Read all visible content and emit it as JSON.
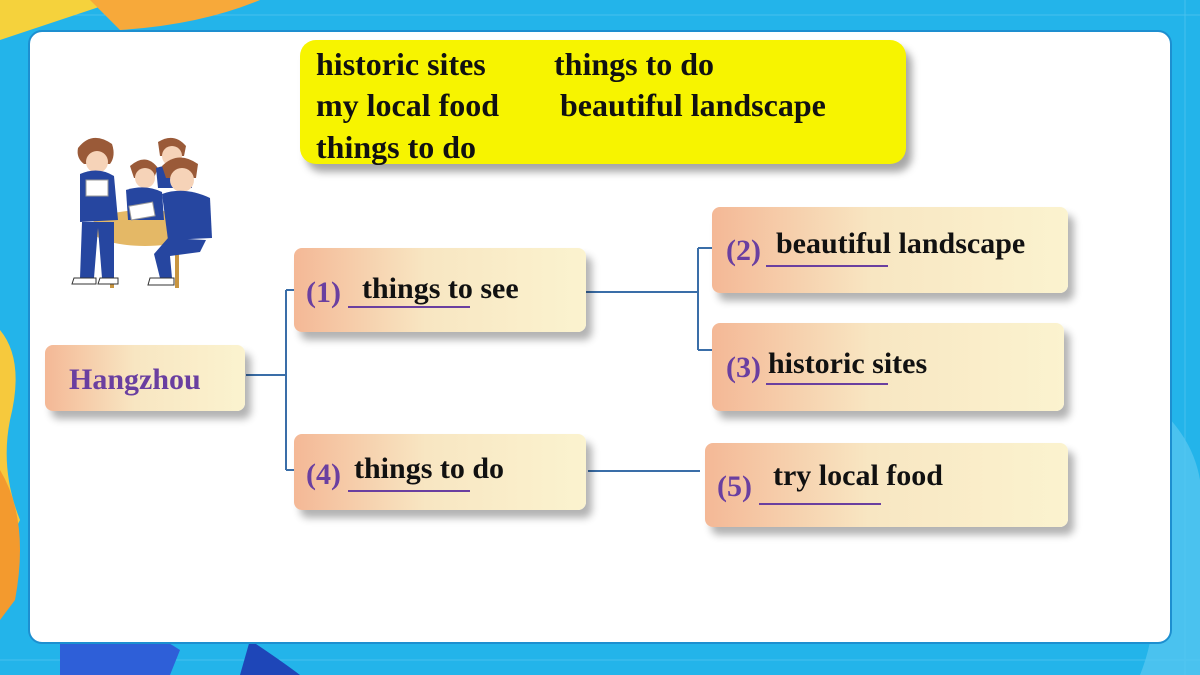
{
  "word_bank": {
    "row1": [
      "historic sites",
      "things to do"
    ],
    "row2": [
      "my local food",
      "beautiful landscape"
    ],
    "row3": [
      "things to do"
    ]
  },
  "mindmap": {
    "root": "Hangzhou",
    "branch1": {
      "num": "(1)",
      "answer": "things to see"
    },
    "branch2": {
      "num": "(2)",
      "answer": "beautiful landscape"
    },
    "branch3": {
      "num": "(3)",
      "answer": "historic sites"
    },
    "branch4": {
      "num": "(4)",
      "answer": "things to do"
    },
    "branch5": {
      "num": "(5)",
      "answer": "try local food"
    }
  },
  "colors": {
    "word_bank_bg": "#f7f400",
    "number_text": "#6a3fa0",
    "connector": "#3a6ea8",
    "box_gradient_start": "#f4b896",
    "box_gradient_end": "#fbf3cf"
  },
  "icons": {
    "illustration": "students-group-icon"
  }
}
